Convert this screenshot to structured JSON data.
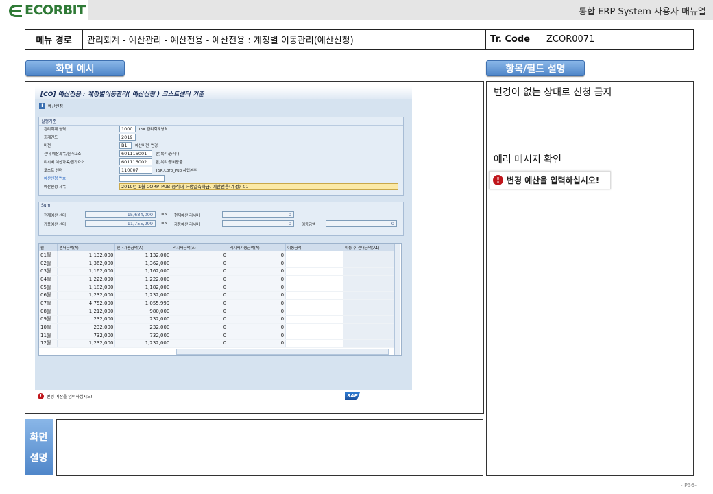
{
  "header": {
    "logo_text": "ECORBIT",
    "doc_title": "통합 ERP System 사용자 매뉴얼"
  },
  "path": {
    "menu_label": "메뉴 경로",
    "menu_value": "관리회계 - 예산관리 - 예산전용 - 예산전용 : 계정별 이동관리(예산신청)",
    "tcode_label": "Tr. Code",
    "tcode_value": "ZCOR0071"
  },
  "sections": {
    "screen_example": "화면 예시",
    "field_desc": "항목/필드 설명",
    "screen_desc_1": "화면",
    "screen_desc_2": "설명"
  },
  "right_panel": {
    "note1": "변경이 없는 상태로 신청 금지",
    "note2": "에러 메시지 확인",
    "error_msg": "변경 예산을 입력하십시오!"
  },
  "sap": {
    "title": "[CO] 예산전용 : 계정별이동관리( 예산신청 ) 코스트센터 기준",
    "toolbar_info_icon": "i",
    "toolbar_label": "예산신청",
    "criteria_title": "실행기준",
    "fields": [
      {
        "label": "관리회계 영역",
        "value": "1000",
        "desc": "TSK 관리회계영역"
      },
      {
        "label": "회계연도",
        "value": "2019",
        "desc": ""
      },
      {
        "label": "버전",
        "value": "B1",
        "desc": "예산버전_변경"
      },
      {
        "label": "센더 예산과목/원가요소",
        "value": "601116001",
        "desc": "판)복리:중식대"
      },
      {
        "label": "리시버 예산과목/원가요소",
        "value": "601116002",
        "desc": "판)복리:창비용품"
      },
      {
        "label": "코스트 센터",
        "value": "110007",
        "desc": "TSK.Corp_Pub 사업본부"
      },
      {
        "label": "예산신청 번호",
        "value": "",
        "desc": ""
      },
      {
        "label": "예산신청 제목",
        "value": "2019년 1월 CORP_PUB 중식대->생일축하금, 예산전용(계정)_01",
        "desc": ""
      }
    ],
    "sum": {
      "title": "Sum",
      "cur_sender_label": "현재예산 센더",
      "cur_sender_value": "15,684,000",
      "cur_receiver_label": "현재예산 리시버",
      "cur_receiver_value": "0",
      "avail_sender_label": "가용예산 센더",
      "avail_sender_value": "11,755,999",
      "avail_receiver_label": "가용예산 리시버",
      "avail_receiver_value": "0",
      "move_label": "이동금액",
      "move_value": "0",
      "arrow": "=>"
    },
    "grid": {
      "columns": [
        "월",
        "센더금액(A)",
        "센더가용금액(A)",
        "리시버금액(A)",
        "리시버가용금액(A)",
        "이동금액",
        "이동 후 센더금액(A1)"
      ],
      "rows": [
        [
          "01월",
          "1,132,000",
          "1,132,000",
          "0",
          "0",
          "",
          ""
        ],
        [
          "02월",
          "1,362,000",
          "1,362,000",
          "0",
          "0",
          "",
          ""
        ],
        [
          "03월",
          "1,162,000",
          "1,162,000",
          "0",
          "0",
          "",
          ""
        ],
        [
          "04월",
          "1,222,000",
          "1,222,000",
          "0",
          "0",
          "",
          ""
        ],
        [
          "05월",
          "1,182,000",
          "1,182,000",
          "0",
          "0",
          "",
          ""
        ],
        [
          "06월",
          "1,232,000",
          "1,232,000",
          "0",
          "0",
          "",
          ""
        ],
        [
          "07월",
          "4,752,000",
          "1,055,999",
          "0",
          "0",
          "",
          ""
        ],
        [
          "08월",
          "1,212,000",
          "980,000",
          "0",
          "0",
          "",
          ""
        ],
        [
          "09월",
          "232,000",
          "232,000",
          "0",
          "0",
          "",
          ""
        ],
        [
          "10월",
          "232,000",
          "232,000",
          "0",
          "0",
          "",
          ""
        ],
        [
          "11월",
          "732,000",
          "732,000",
          "0",
          "0",
          "",
          ""
        ],
        [
          "12월",
          "1,232,000",
          "1,232,000",
          "0",
          "0",
          "",
          ""
        ]
      ]
    },
    "status_message": "변경 예산을 입력하십시오!",
    "sap_logo": "SAP"
  },
  "footer": {
    "page": "- P36-"
  },
  "colors": {
    "brand_green": "#2f7a36",
    "tab_blue": "#4f86c9",
    "error_red": "#c0161c"
  }
}
